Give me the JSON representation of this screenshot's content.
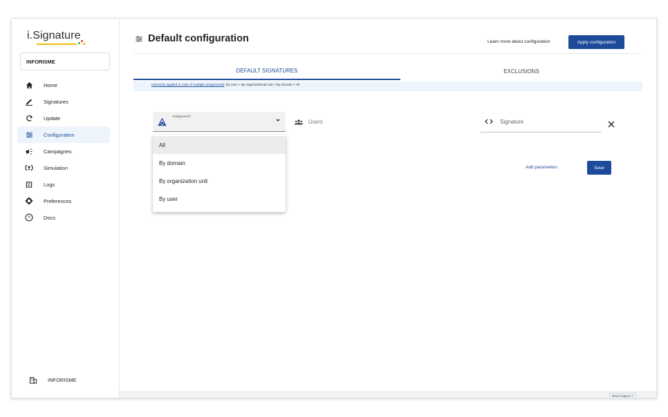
{
  "app": {
    "logo": "i.Signature",
    "logo_colors": [
      "#f2b705",
      "#1db954",
      "#e53935",
      "#1d4b9a"
    ],
    "organization": "INFORISME",
    "footer_org": "INFORISME"
  },
  "sidebar": {
    "items": [
      {
        "label": "Home",
        "icon": "home-icon"
      },
      {
        "label": "Signatures",
        "icon": "pen-icon"
      },
      {
        "label": "Update",
        "icon": "refresh-icon"
      },
      {
        "label": "Configuration",
        "icon": "sliders-icon"
      },
      {
        "label": "Campagnes",
        "icon": "megaphone-icon"
      },
      {
        "label": "Simulation",
        "icon": "simulation-icon"
      },
      {
        "label": "Logs",
        "icon": "logs-icon"
      },
      {
        "label": "Preferences",
        "icon": "gear-icon"
      },
      {
        "label": "Docs",
        "icon": "help-icon"
      }
    ],
    "active_index": 3
  },
  "header": {
    "title": "Default configuration",
    "learn_more": "Learn more about configuration",
    "apply_button": "Apply configuration"
  },
  "tabs": [
    {
      "label": "DEFAULT SIGNATURES",
      "active": true
    },
    {
      "label": "EXCLUSIONS",
      "active": false
    }
  ],
  "hint": {
    "link": "Hierarchy applied in case of multiple assignments",
    "text": ": By user > By organizational unit > By domain > All"
  },
  "form": {
    "assignment_label": "Assignment*",
    "users_placeholder": "Users",
    "signature_placeholder": "Signature",
    "add_parameters": "Add parameters",
    "save_button": "Save"
  },
  "dropdown": {
    "options": [
      "All",
      "By domain",
      "By organization unit",
      "By user"
    ],
    "highlighted_index": 0
  },
  "footer": {
    "support": "Need support ?"
  },
  "colors": {
    "primary": "#1d4b9a",
    "active_bg": "#eef4fb"
  }
}
